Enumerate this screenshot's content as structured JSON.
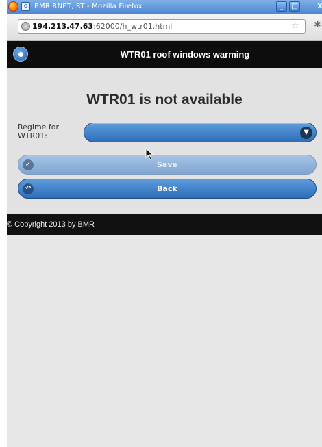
{
  "window": {
    "title": "BMR RNET, RT - Mozilla Firefox",
    "sys_menu": "o",
    "minimize": "_",
    "maximize": "□",
    "close": "x"
  },
  "browser": {
    "url_host": "194.213.47.63",
    "url_rest": ":62000/h_wtr01.html"
  },
  "header": {
    "title": "WTR01 roof windows warming"
  },
  "main": {
    "heading": "WTR01 is not available",
    "regime_label": "Regime for WTR01:",
    "regime_value": "",
    "save_label": "Save",
    "back_label": "Back"
  },
  "footer": {
    "text": "© Copyright 2013 by BMR"
  },
  "colors": {
    "header_bg": "#0d0d0d",
    "button_blue": "#3d7fc9",
    "content_bg": "#e2e2e2"
  }
}
